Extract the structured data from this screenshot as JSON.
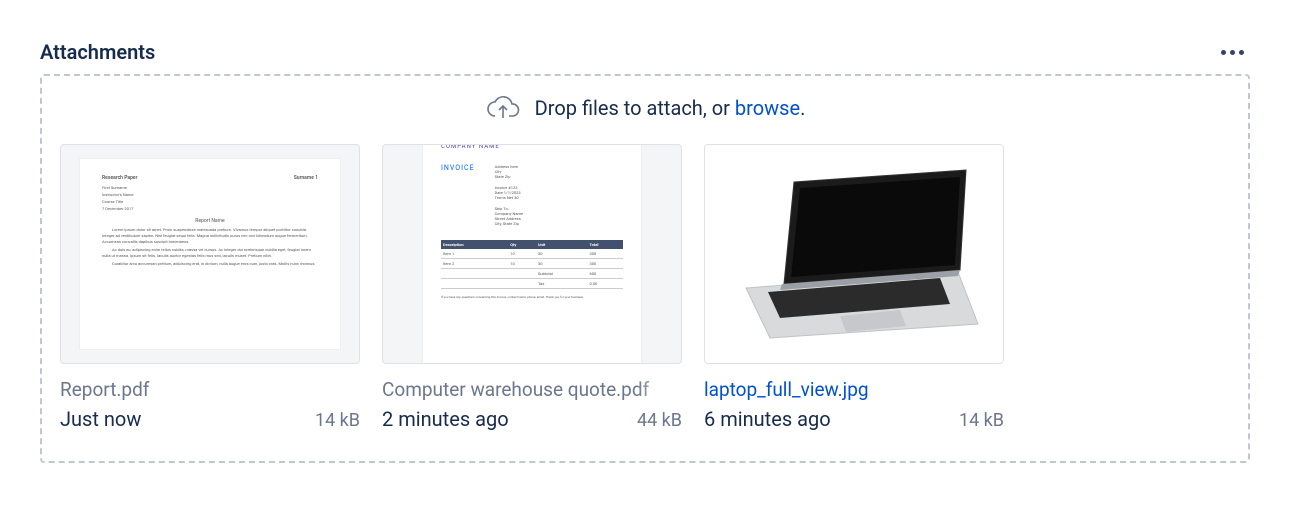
{
  "section": {
    "title": "Attachments"
  },
  "dropzone": {
    "hint_prefix": "Drop files to attach, or ",
    "browse_label": "browse",
    "hint_suffix": "."
  },
  "attachments": [
    {
      "filename": "Report.pdf",
      "time": "Just now",
      "size": "14 kB",
      "is_link": false,
      "preview_kind": "document"
    },
    {
      "filename": "Computer warehouse quote.pdf",
      "time": "2 minutes ago",
      "size": "44 kB",
      "is_link": false,
      "preview_kind": "invoice"
    },
    {
      "filename": "laptop_full_view.jpg",
      "time": "6 minutes ago",
      "size": "14 kB",
      "is_link": true,
      "preview_kind": "laptop-photo"
    }
  ]
}
